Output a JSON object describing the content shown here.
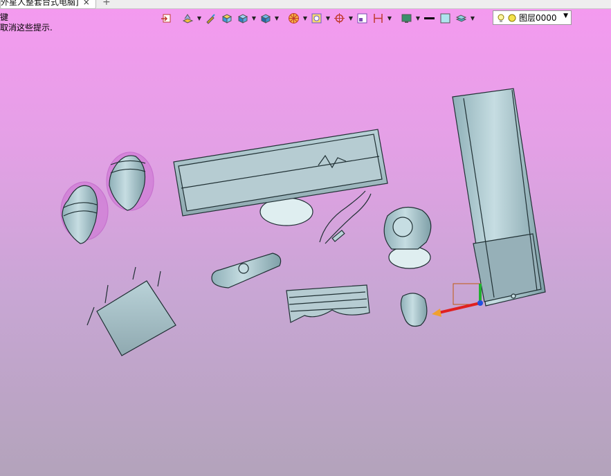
{
  "document_tab": {
    "title": "外星人整套台式电脑]",
    "close_symbol": "×",
    "new_tab_symbol": "+"
  },
  "hints": {
    "line1": "键",
    "line2": "取消这些提示."
  },
  "toolbar": {
    "icons": [
      "import-icon",
      "layer-stack-icon",
      "brush-icon",
      "cube-face-icon",
      "cube-icon",
      "cube-view-icon",
      "wheel-icon",
      "frame-icon",
      "crosshair-icon",
      "window-icon",
      "dimension-icon",
      "display-icon",
      "line-color-icon",
      "fill-color-icon",
      "layer-manager-icon"
    ]
  },
  "layer_selector": {
    "value": "图层0000",
    "icons": [
      "bulb-icon",
      "sun-icon"
    ]
  },
  "colors": {
    "background_top": "#f59af0",
    "background_bottom": "#b3a3bb",
    "model_fill": "#a9c4cc",
    "model_edge": "#1f2f33",
    "axis_x": "#e02020",
    "axis_y": "#20b030",
    "axis_z": "#2050e0"
  }
}
